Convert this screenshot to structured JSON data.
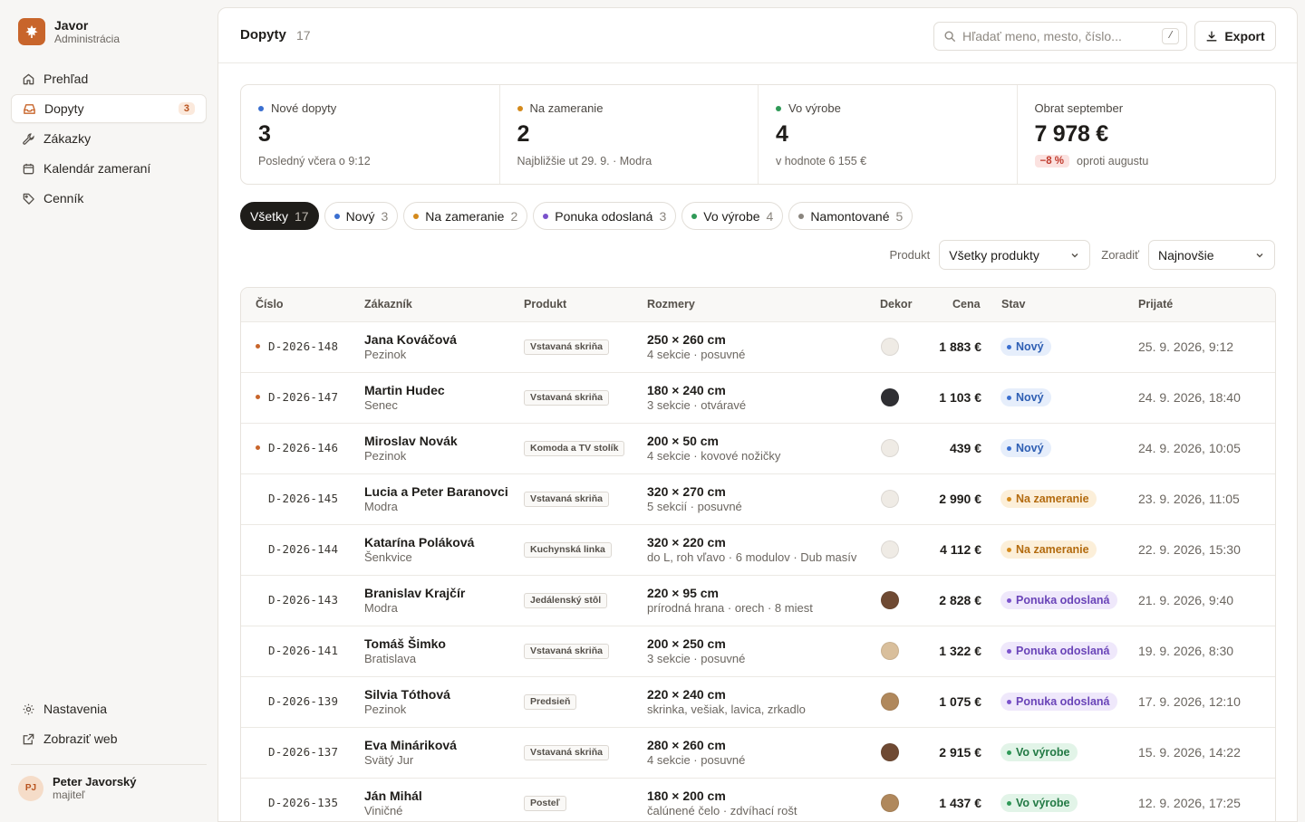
{
  "app": {
    "name": "Javor",
    "subtitle": "Administrácia"
  },
  "nav": {
    "items": [
      {
        "label": "Prehľad",
        "icon": "home-icon"
      },
      {
        "label": "Dopyty",
        "icon": "inbox-icon",
        "badge": "3",
        "active": true
      },
      {
        "label": "Zákazky",
        "icon": "wrench-icon"
      },
      {
        "label": "Kalendár zameraní",
        "icon": "calendar-icon"
      },
      {
        "label": "Cenník",
        "icon": "tag-icon"
      }
    ],
    "bottom": [
      {
        "label": "Nastavenia",
        "icon": "gear-icon"
      },
      {
        "label": "Zobraziť web",
        "icon": "external-link-icon"
      }
    ]
  },
  "user": {
    "initials": "PJ",
    "name": "Peter Javorský",
    "role": "majiteľ"
  },
  "header": {
    "title": "Dopyty",
    "count": "17",
    "search_placeholder": "Hľadať meno, mesto, číslo...",
    "search_shortcut": "/",
    "export_label": "Export"
  },
  "stats": [
    {
      "label": "Nové dopyty",
      "dot": "#3a6fd0",
      "value": "3",
      "sub": "Posledný včera o 9:12"
    },
    {
      "label": "Na zameranie",
      "dot": "#d48a1c",
      "value": "2",
      "sub": "Najbližšie ut 29. 9. · Modra"
    },
    {
      "label": "Vo výrobe",
      "dot": "#2f9a57",
      "value": "4",
      "sub": "v hodnote 6 155 €"
    },
    {
      "label": "Obrat september",
      "value": "7 978 €",
      "delta": "−8 %",
      "sub": "oproti augustu"
    }
  ],
  "chips": [
    {
      "label": "Všetky",
      "count": "17",
      "active": true
    },
    {
      "label": "Nový",
      "count": "3",
      "dot": "#3a6fd0"
    },
    {
      "label": "Na zameranie",
      "count": "2",
      "dot": "#d48a1c"
    },
    {
      "label": "Ponuka odoslaná",
      "count": "3",
      "dot": "#7a52cc"
    },
    {
      "label": "Vo výrobe",
      "count": "4",
      "dot": "#2f9a57"
    },
    {
      "label": "Namontované",
      "count": "5",
      "dot": "#8a857e"
    }
  ],
  "filters": {
    "product_label": "Produkt",
    "product_value": "Všetky produkty",
    "sort_label": "Zoradiť",
    "sort_value": "Najnovšie"
  },
  "table": {
    "columns": [
      "Číslo",
      "Zákazník",
      "Produkt",
      "Rozmery",
      "Dekor",
      "Cena",
      "Stav",
      "Prijaté"
    ],
    "rows": [
      {
        "id": "D-2026-148",
        "unread": true,
        "name": "Jana Kováčová",
        "city": "Pezinok",
        "product": "Vstavaná skriňa",
        "dim": "250 × 260 cm",
        "note": "4 sekcie · posuvné",
        "decor": "#efebe5",
        "price": "1 883 €",
        "status": "Nový",
        "status_kind": "new",
        "date": "25. 9. 2026, 9:12"
      },
      {
        "id": "D-2026-147",
        "unread": true,
        "name": "Martin Hudec",
        "city": "Senec",
        "product": "Vstavaná skriňa",
        "dim": "180 × 240 cm",
        "note": "3 sekcie · otváravé",
        "decor": "#2f2f33",
        "price": "1 103 €",
        "status": "Nový",
        "status_kind": "new",
        "date": "24. 9. 2026, 18:40"
      },
      {
        "id": "D-2026-146",
        "unread": true,
        "name": "Miroslav Novák",
        "city": "Pezinok",
        "product": "Komoda a TV stolík",
        "dim": "200 × 50 cm",
        "note": "4 sekcie · kovové nožičky",
        "decor": "#efebe5",
        "price": "439 €",
        "status": "Nový",
        "status_kind": "new",
        "date": "24. 9. 2026, 10:05"
      },
      {
        "id": "D-2026-145",
        "unread": false,
        "name": "Lucia a Peter Baranovci",
        "city": "Modra",
        "product": "Vstavaná skriňa",
        "dim": "320 × 270 cm",
        "note": "5 sekcií · posuvné",
        "decor": "#efebe5",
        "price": "2 990 €",
        "status": "Na zameranie",
        "status_kind": "meas",
        "date": "23. 9. 2026, 11:05"
      },
      {
        "id": "D-2026-144",
        "unread": false,
        "name": "Katarína Poláková",
        "city": "Šenkvice",
        "product": "Kuchynská linka",
        "dim": "320 × 220 cm",
        "note": "do L, roh vľavo · 6 modulov · Dub masív",
        "decor": "#efebe5",
        "price": "4 112 €",
        "status": "Na zameranie",
        "status_kind": "meas",
        "date": "22. 9. 2026, 15:30"
      },
      {
        "id": "D-2026-143",
        "unread": false,
        "name": "Branislav Krajčír",
        "city": "Modra",
        "product": "Jedálenský stôl",
        "dim": "220 × 95 cm",
        "note": "prírodná hrana · orech · 8 miest",
        "decor": "#6f4a33",
        "price": "2 828 €",
        "status": "Ponuka odoslaná",
        "status_kind": "offer",
        "date": "21. 9. 2026, 9:40"
      },
      {
        "id": "D-2026-141",
        "unread": false,
        "name": "Tomáš Šimko",
        "city": "Bratislava",
        "product": "Vstavaná skriňa",
        "dim": "200 × 250 cm",
        "note": "3 sekcie · posuvné",
        "decor": "#d9bf9c",
        "price": "1 322 €",
        "status": "Ponuka odoslaná",
        "status_kind": "offer",
        "date": "19. 9. 2026, 8:30"
      },
      {
        "id": "D-2026-139",
        "unread": false,
        "name": "Silvia Tóthová",
        "city": "Pezinok",
        "product": "Predsieň",
        "dim": "220 × 240 cm",
        "note": "skrinka, vešiak, lavica, zrkadlo",
        "decor": "#b0885c",
        "price": "1 075 €",
        "status": "Ponuka odoslaná",
        "status_kind": "offer",
        "date": "17. 9. 2026, 12:10"
      },
      {
        "id": "D-2026-137",
        "unread": false,
        "name": "Eva Mináriková",
        "city": "Svätý Jur",
        "product": "Vstavaná skriňa",
        "dim": "280 × 260 cm",
        "note": "4 sekcie · posuvné",
        "decor": "#6f4a33",
        "price": "2 915 €",
        "status": "Vo výrobe",
        "status_kind": "prod",
        "date": "15. 9. 2026, 14:22"
      },
      {
        "id": "D-2026-135",
        "unread": false,
        "name": "Ján Mihál",
        "city": "Viničné",
        "product": "Posteľ",
        "dim": "180 × 200 cm",
        "note": "čalúnené čelo · zdvíhací rošt",
        "decor": "#b0885c",
        "price": "1 437 €",
        "status": "Vo výrobe",
        "status_kind": "prod",
        "date": "12. 9. 2026, 17:25"
      }
    ]
  }
}
